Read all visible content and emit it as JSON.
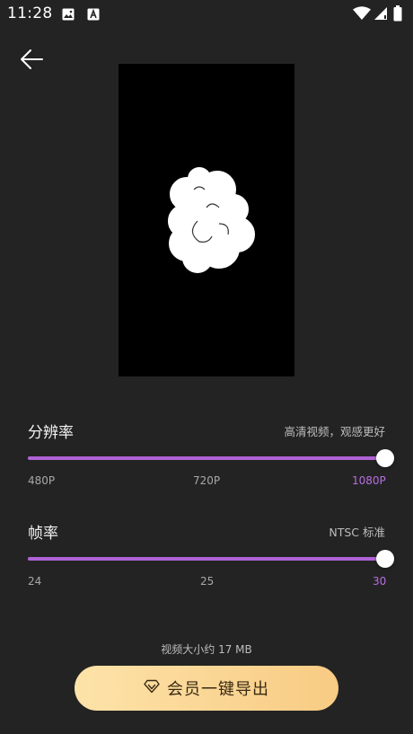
{
  "status_bar": {
    "time": "11:28",
    "icons": [
      "image-icon",
      "font-a-icon",
      "wifi-icon",
      "signal-icon",
      "battery-icon"
    ]
  },
  "header": {
    "back_icon": "arrow-left-icon"
  },
  "resolution": {
    "title": "分辨率",
    "description": "高清视频，观感更好",
    "options": [
      "480P",
      "720P",
      "1080P"
    ],
    "selected": "1080P",
    "value_fraction": 1.0
  },
  "framerate": {
    "title": "帧率",
    "description": "NTSC 标准",
    "options": [
      "24",
      "25",
      "30"
    ],
    "selected": "30",
    "value_fraction": 1.0
  },
  "footer": {
    "size_text": "视频大小约 17 MB",
    "export_label": "会员一键导出",
    "export_icon": "diamond-icon"
  },
  "colors": {
    "background": "#232323",
    "accent": "#b063d6",
    "button_gradient_start": "#fde3a9",
    "button_gradient_end": "#f8cb83"
  }
}
